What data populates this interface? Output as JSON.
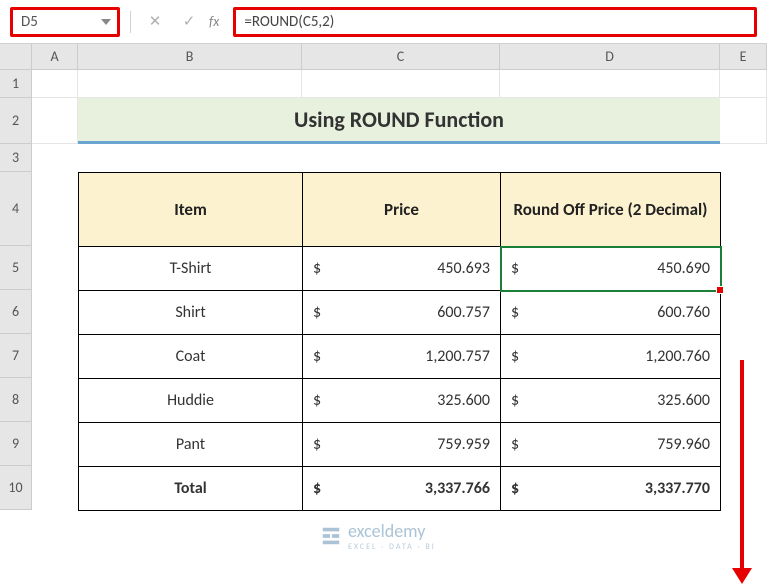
{
  "name_box": "D5",
  "formula": "=ROUND(C5,2)",
  "columns": [
    "A",
    "B",
    "C",
    "D",
    "E"
  ],
  "rows": [
    "1",
    "2",
    "3",
    "4",
    "5",
    "6",
    "7",
    "8",
    "9",
    "10"
  ],
  "title": "Using ROUND Function",
  "headers": {
    "item": "Item",
    "price": "Price",
    "round": "Round Off Price (2 Decimal)"
  },
  "currency": "$",
  "items": [
    {
      "name": "T-Shirt",
      "price": "450.693",
      "round": "450.690"
    },
    {
      "name": "Shirt",
      "price": "600.757",
      "round": "600.760"
    },
    {
      "name": "Coat",
      "price": "1,200.757",
      "round": "1,200.760"
    },
    {
      "name": "Huddie",
      "price": "325.600",
      "round": "325.600"
    },
    {
      "name": "Pant",
      "price": "759.959",
      "round": "759.960"
    }
  ],
  "total": {
    "label": "Total",
    "price": "3,337.766",
    "round": "3,337.770"
  },
  "watermark": {
    "brand": "exceldemy",
    "tagline": "EXCEL · DATA · BI"
  },
  "chart_data": {
    "type": "table",
    "title": "Using ROUND Function",
    "columns": [
      "Item",
      "Price",
      "Round Off Price (2 Decimal)"
    ],
    "rows": [
      [
        "T-Shirt",
        450.693,
        450.69
      ],
      [
        "Shirt",
        600.757,
        600.76
      ],
      [
        "Coat",
        1200.757,
        1200.76
      ],
      [
        "Huddie",
        325.6,
        325.6
      ],
      [
        "Pant",
        759.959,
        759.96
      ],
      [
        "Total",
        3337.766,
        3337.77
      ]
    ]
  }
}
